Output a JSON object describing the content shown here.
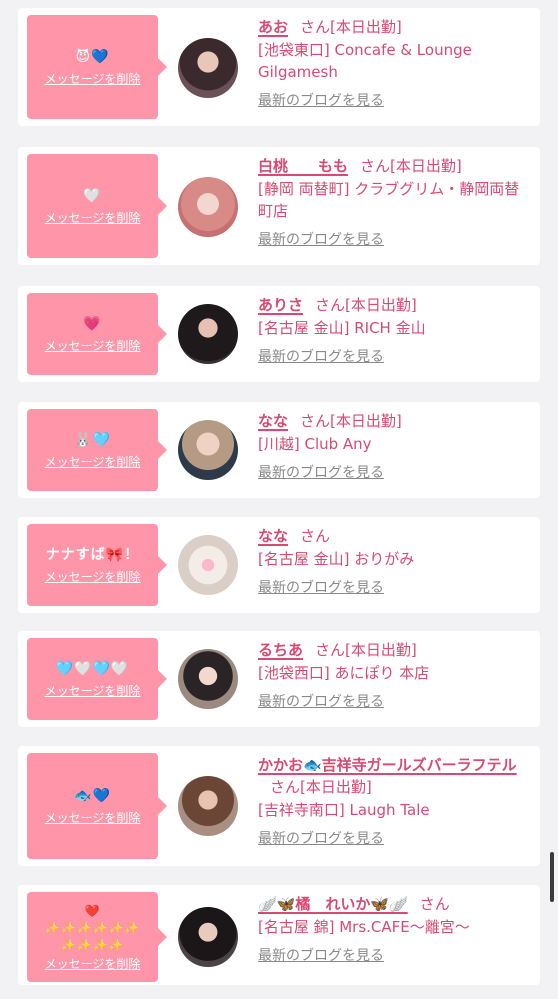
{
  "delete_label": "メッセージを削除",
  "blog_label": "最新のブログを見る",
  "suffix": "さん",
  "accent_color": "#d94a72",
  "bubble_color": "#ff95a8",
  "items": [
    {
      "message": "😈💙",
      "name": "あお",
      "status": "[本日出勤]",
      "shop": "[池袋東口] Concafe & Lounge Gilgamesh"
    },
    {
      "message": "🤍",
      "name": "白桃　　もも",
      "status": "[本日出勤]",
      "shop": "[静岡 両替町] クラブグリム・静岡両替町店"
    },
    {
      "message": "💗",
      "name": "ありさ",
      "status": "[本日出勤]",
      "shop": "[名古屋 金山] RICH 金山"
    },
    {
      "message": "🐰🩵",
      "name": "なな",
      "status": "[本日出勤]",
      "shop": "[川越] Club Any"
    },
    {
      "message": "ナナすば🎀！",
      "name": "なな",
      "status": "",
      "shop": "[名古屋 金山] おりがみ"
    },
    {
      "message": "🩵🤍🩵🤍",
      "name": "るちあ",
      "status": "[本日出勤]",
      "shop": "[池袋西口] あにぽり 本店"
    },
    {
      "message": "🐟💙",
      "name": "かかお🐟吉祥寺ガールズバーラフテル",
      "status": "[本日出勤]",
      "shop": "[吉祥寺南口] Laugh Tale"
    },
    {
      "message": "❤️\n✨✨✨✨✨✨\n✨✨✨✨",
      "name": "🪽🦋橘　れいか🦋🪽",
      "status": "",
      "shop": "[名古屋 錦] Mrs.CAFE〜離宮〜"
    }
  ]
}
